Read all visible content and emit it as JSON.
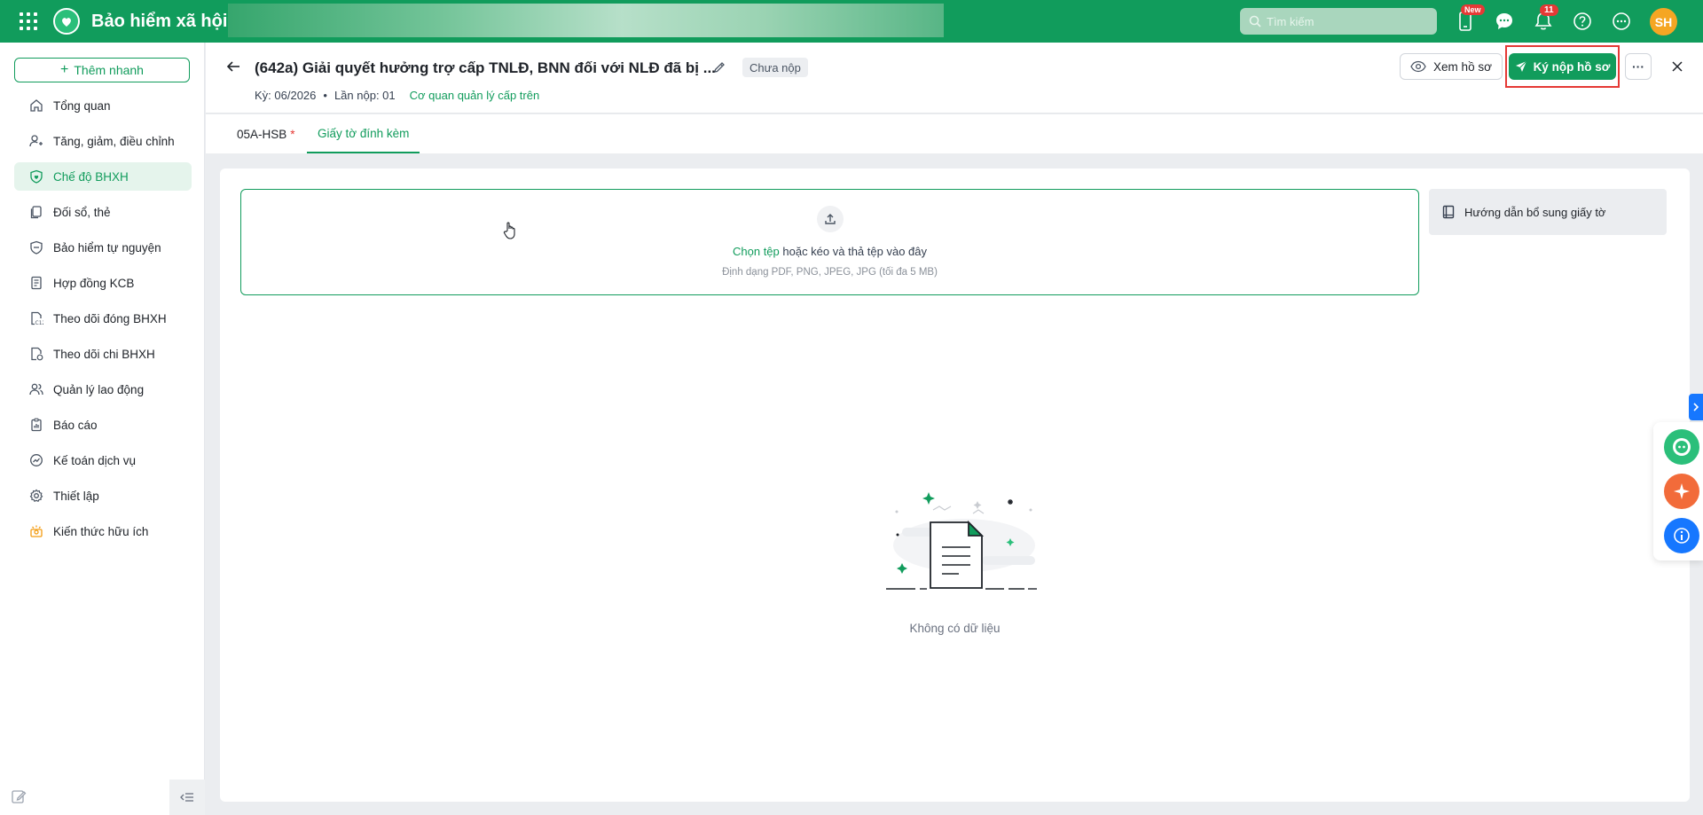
{
  "app": {
    "title": "Bảo hiểm xã hội"
  },
  "topbar": {
    "search_placeholder": "Tìm kiếm",
    "mobile_badge": "New",
    "notification_count": "11",
    "avatar_initials": "SH"
  },
  "sidebar": {
    "quick_add": "Thêm nhanh",
    "items": [
      {
        "label": "Tổng quan",
        "icon": "home-icon"
      },
      {
        "label": "Tăng, giảm, điều chỉnh",
        "icon": "user-adjust-icon"
      },
      {
        "label": "Chế độ BHXH",
        "icon": "shield-heart-icon",
        "active": true
      },
      {
        "label": "Đối sổ, thẻ",
        "icon": "cards-icon"
      },
      {
        "label": "Bảo hiểm tự nguyện",
        "icon": "shield-icon"
      },
      {
        "label": "Hợp đồng KCB",
        "icon": "contract-icon"
      },
      {
        "label": "Theo dõi đóng BHXH",
        "icon": "c12-icon"
      },
      {
        "label": "Theo dõi chi BHXH",
        "icon": "document-money-icon"
      },
      {
        "label": "Quản lý lao động",
        "icon": "users-icon"
      },
      {
        "label": "Báo cáo",
        "icon": "report-icon"
      },
      {
        "label": "Kế toán dịch vụ",
        "icon": "accounting-icon"
      },
      {
        "label": "Thiết lập",
        "icon": "gear-icon"
      },
      {
        "label": "Kiến thức hữu ích",
        "icon": "lightbulb-icon"
      }
    ]
  },
  "header": {
    "title": "(642a) Giải quyết hưởng trợ cấp TNLĐ, BNN đối với NLĐ đã bị ...",
    "status": "Chưa nộp",
    "period": "Kỳ: 06/2026",
    "submission": "Lần nộp: 01",
    "agency_link": "Cơ quan quản lý cấp trên",
    "view_button": "Xem hồ sơ",
    "sign_button": "Ký nộp hồ sơ",
    "more_button": "···"
  },
  "tabs": [
    {
      "label": "05A-HSB",
      "required": "*"
    },
    {
      "label": "Giấy tờ đính kèm",
      "active": true
    }
  ],
  "upload": {
    "choose_file": "Chọn tệp",
    "drag_text": " hoặc kéo và thả tệp vào đây",
    "formats": "Định dạng PDF, PNG, JPEG, JPG (tối đa 5 MB)"
  },
  "guide": {
    "label": "Hướng dẫn bổ sung giấy tờ"
  },
  "empty": {
    "text": "Không có dữ liệu"
  },
  "colors": {
    "brand": "#119c5c",
    "highlight": "#e53935",
    "accent_blue": "#1677ff"
  }
}
